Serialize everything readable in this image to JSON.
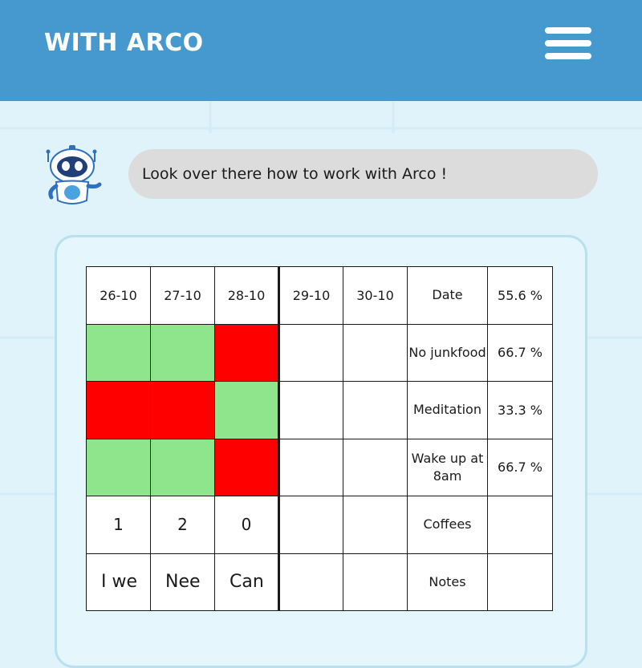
{
  "header": {
    "title": "WITH ARCO",
    "menu_icon": "hamburger-menu-icon"
  },
  "colors": {
    "header_bg": "#4599cf",
    "page_bg": "#e0f3fb",
    "success": "#8ee58b",
    "fail": "#ff0000",
    "bubble_bg": "#dcdcdc"
  },
  "assistant": {
    "avatar_icon": "robot-mascot-icon",
    "message": "Look over there how to work with Arco !"
  },
  "tracker": {
    "dates": [
      "26-10",
      "27-10",
      "28-10",
      "29-10",
      "30-10"
    ],
    "date_label": "Date",
    "date_percent": "55.6 %",
    "habits": [
      {
        "label": "No junkfood",
        "percent": "66.7 %",
        "status": [
          "done",
          "done",
          "missed",
          "",
          ""
        ]
      },
      {
        "label": "Meditation",
        "percent": "33.3 %",
        "status": [
          "missed",
          "missed",
          "done",
          "",
          ""
        ]
      },
      {
        "label": "Wake up at 8am",
        "percent": "66.7 %",
        "status": [
          "done",
          "done",
          "missed",
          "",
          ""
        ]
      }
    ],
    "coffees": {
      "label": "Coffees",
      "values": [
        "1",
        "2",
        "0",
        "",
        ""
      ],
      "percent": ""
    },
    "notes": {
      "label": "Notes",
      "values": [
        "I we",
        "Nee",
        "Can",
        "",
        ""
      ],
      "percent": ""
    }
  }
}
